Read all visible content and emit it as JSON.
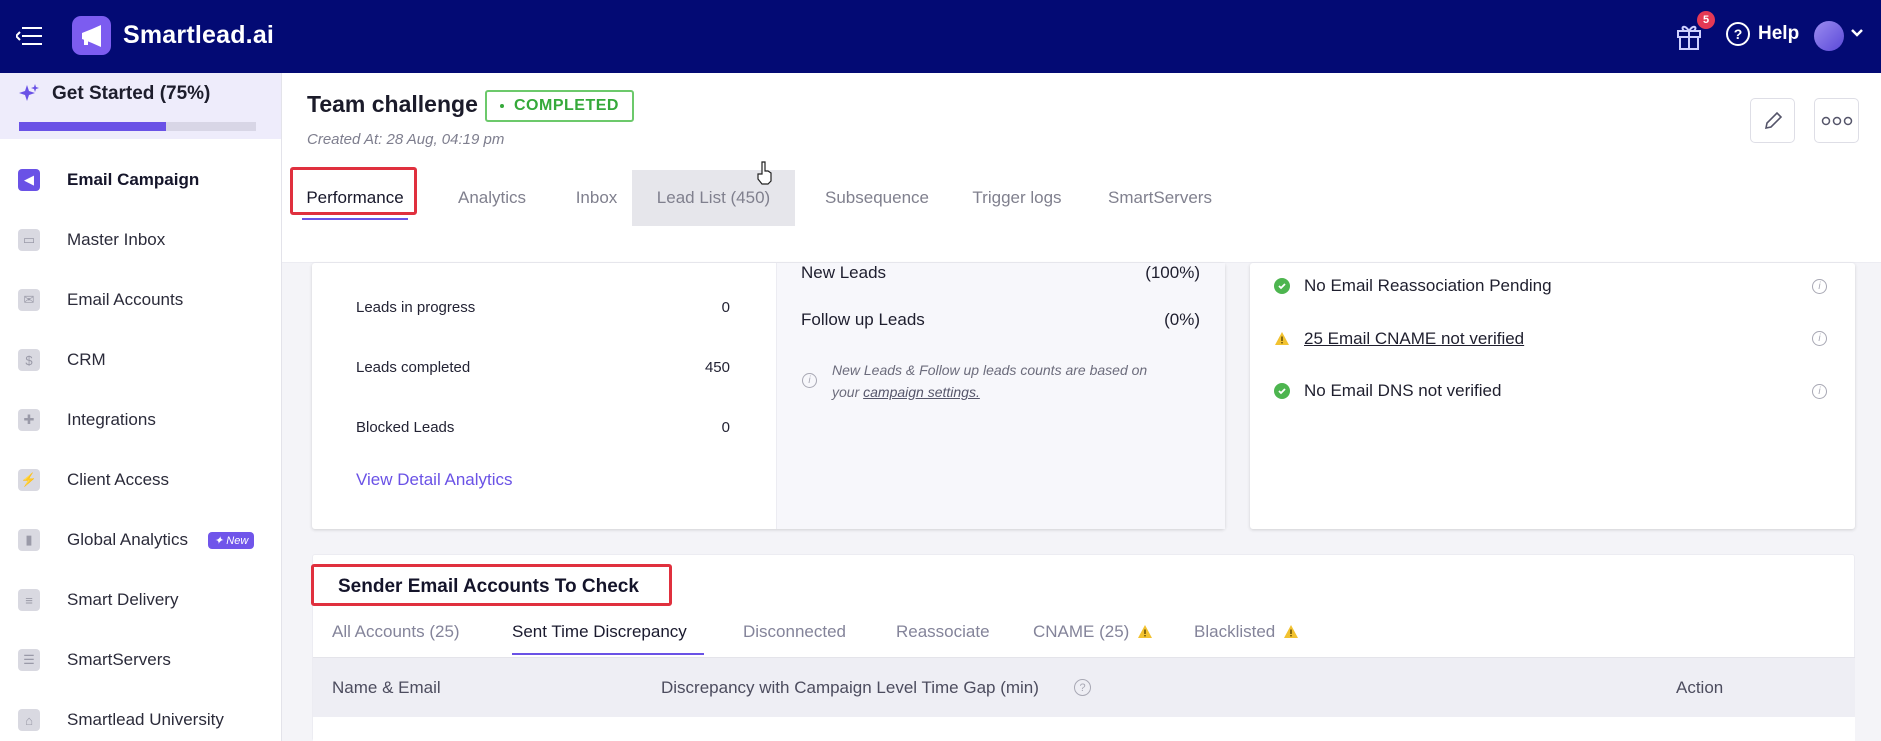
{
  "brand": {
    "name": "Smartlead.ai"
  },
  "topbar": {
    "gift_badge_count": "5",
    "help_label": "Help"
  },
  "sidebar": {
    "get_started": {
      "label": "Get Started (75%)",
      "progress": 0.62
    },
    "items": [
      {
        "label": "Email Campaign",
        "icon": "megaphone-icon",
        "active": true
      },
      {
        "label": "Master Inbox",
        "icon": "inbox-icon"
      },
      {
        "label": "Email Accounts",
        "icon": "envelope-icon"
      },
      {
        "label": "CRM",
        "icon": "dollar-icon"
      },
      {
        "label": "Integrations",
        "icon": "puzzle-icon"
      },
      {
        "label": "Client Access",
        "icon": "bolt-icon"
      },
      {
        "label": "Global Analytics",
        "icon": "bar-chart-icon",
        "badge": "New"
      },
      {
        "label": "Smart Delivery",
        "icon": "layers-icon"
      },
      {
        "label": "SmartServers",
        "icon": "server-icon"
      },
      {
        "label": "Smartlead University",
        "icon": "university-icon"
      }
    ]
  },
  "campaign": {
    "title": "Team challenge",
    "status": "COMPLETED",
    "created_at": "Created At: 28 Aug, 04:19 pm"
  },
  "tabs": [
    {
      "label": "Performance",
      "active": true
    },
    {
      "label": "Analytics"
    },
    {
      "label": "Inbox"
    },
    {
      "label": "Lead List (450)"
    },
    {
      "label": "Subsequence"
    },
    {
      "label": "Trigger logs"
    },
    {
      "label": "SmartServers"
    }
  ],
  "lead_stats": {
    "rows": [
      {
        "label": "Leads in progress",
        "value": "0"
      },
      {
        "label": "Leads completed",
        "value": "450"
      },
      {
        "label": "Blocked Leads",
        "value": "0"
      }
    ],
    "detail_link": "View Detail Analytics"
  },
  "lead_types": {
    "rows": [
      {
        "label": "New Leads",
        "value": "(100%)"
      },
      {
        "label": "Follow up Leads",
        "value": "(0%)"
      }
    ],
    "note_prefix": "New Leads & Follow up leads counts are based on your",
    "note_link": "campaign settings."
  },
  "health_checks": [
    {
      "label": "No Email Reassociation Pending",
      "status": "ok"
    },
    {
      "label": "25 Email CNAME not verified",
      "status": "warning"
    },
    {
      "label": "No Email DNS not verified",
      "status": "ok"
    }
  ],
  "sender_section": {
    "title": "Sender Email Accounts To Check",
    "tabs": [
      {
        "label": "All Accounts (25)"
      },
      {
        "label": "Sent Time Discrepancy",
        "active": true
      },
      {
        "label": "Disconnected"
      },
      {
        "label": "Reassociate"
      },
      {
        "label": "CNAME (25)",
        "warning": true
      },
      {
        "label": "Blacklisted",
        "warning": true
      }
    ],
    "columns": [
      "Name & Email",
      "Discrepancy with Campaign Level Time Gap (min)",
      "Action"
    ]
  },
  "colors": {
    "topbar": "#030a74",
    "accent": "#6a52e6",
    "success": "#35a93a",
    "highlight": "#e0303e"
  }
}
